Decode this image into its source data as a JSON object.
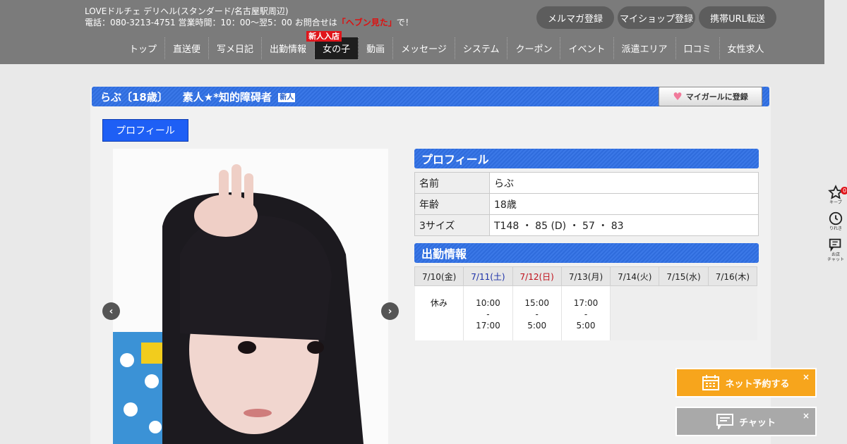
{
  "header": {
    "shop_line": "LOVEドルチェ デリヘル(スタンダード/名古屋駅周辺)",
    "contact_prefix": "電話：080-3213-4751 営業時間：10：00～翌5：00 お問合せは",
    "contact_highlight": "「ヘブン見た」",
    "contact_suffix": "で！",
    "buttons": [
      "メルマガ登録",
      "マイショップ登録",
      "携帯URL転送"
    ]
  },
  "nav": {
    "items": [
      "トップ",
      "直送便",
      "写メ日記",
      "出勤情報",
      "女の子",
      "動画",
      "メッセージ",
      "システム",
      "クーポン",
      "イベント",
      "派遣エリア",
      "口コミ",
      "女性求人"
    ],
    "active_index": 4,
    "badge": "新人入店"
  },
  "profile_header": {
    "name_age": "らぶ〔18歳〕",
    "catch": "素人★*知的障碍者",
    "new_tag": "新人",
    "mygirl_button": "マイガールに登録"
  },
  "tab_label": "プロフィール",
  "profile": {
    "heading": "プロフィール",
    "rows": [
      {
        "key": "名前",
        "value": "らぶ"
      },
      {
        "key": "年齢",
        "value": "18歳"
      },
      {
        "key": "3サイズ",
        "value": "T148 ・ 85 (D) ・ 57 ・ 83"
      }
    ]
  },
  "schedule": {
    "heading": "出勤情報",
    "days": [
      {
        "date": "7/10(金)",
        "kind": "weekday",
        "lines": [
          "休み"
        ]
      },
      {
        "date": "7/11(土)",
        "kind": "sat",
        "lines": [
          "10:00",
          "-",
          "17:00"
        ]
      },
      {
        "date": "7/12(日)",
        "kind": "sun",
        "lines": [
          "15:00",
          "-",
          "5:00"
        ]
      },
      {
        "date": "7/13(月)",
        "kind": "weekday",
        "lines": [
          "17:00",
          "-",
          "5:00"
        ]
      },
      {
        "date": "7/14(火)",
        "kind": "weekday",
        "lines": []
      },
      {
        "date": "7/15(水)",
        "kind": "weekday",
        "lines": []
      },
      {
        "date": "7/16(木)",
        "kind": "weekday",
        "lines": []
      }
    ]
  },
  "side_widget": {
    "keep_label": "キープ",
    "keep_count": "0",
    "history_label": "りれき",
    "chat_label_1": "お店",
    "chat_label_2": "チャット"
  },
  "float": {
    "reserve_label": "ネット予約する",
    "chat_label": "チャット",
    "close": "×"
  },
  "colors": {
    "header_bg": "#7b7b7b",
    "accent_blue": "#3b78e7",
    "reserve_orange": "#f7a51c",
    "sat_color": "#1b2fa8",
    "sun_color": "#c0101a"
  }
}
